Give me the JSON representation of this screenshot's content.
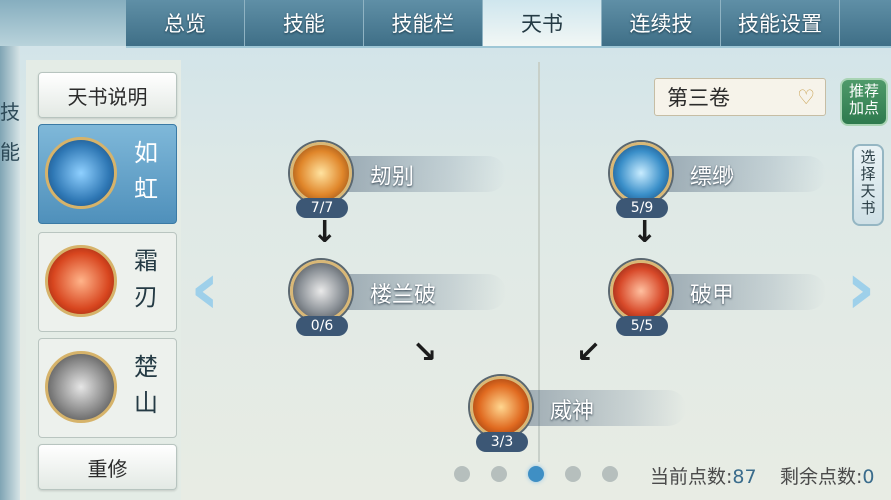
{
  "tabs": [
    "总览",
    "技能",
    "技能栏",
    "天书",
    "连续技",
    "技能设置"
  ],
  "active_tab": "天书",
  "left_edge_chars": [
    "技",
    "能"
  ],
  "left_panel": {
    "info_button": "天书说明",
    "books": [
      {
        "name": "如虹",
        "selected": true,
        "color": "#2f78b5"
      },
      {
        "name": "霜刃",
        "selected": false,
        "color": "#d8461f"
      },
      {
        "name": "楚山",
        "selected": false,
        "color": "#5c5c5c"
      }
    ],
    "reset_button": "重修"
  },
  "volume": {
    "label": "第三卷",
    "icon": "chevron-down-icon"
  },
  "side_buttons": {
    "recommend": "推荐加点",
    "choose": "选择天书"
  },
  "skills": [
    {
      "name": "刼别",
      "level": "7/7",
      "color": "#e0862a"
    },
    {
      "name": "楼兰破",
      "level": "0/6",
      "color": "#8a9096"
    },
    {
      "name": "缥缈",
      "level": "5/9",
      "color": "#3a8fc9"
    },
    {
      "name": "破甲",
      "level": "5/5",
      "color": "#d84a2a"
    },
    {
      "name": "威神",
      "level": "3/3",
      "color": "#e06a20"
    }
  ],
  "pager": {
    "count": 5,
    "active_index": 2
  },
  "points": {
    "current_label": "当前点数:",
    "current_value": "87",
    "remaining_label": "剩余点数:",
    "remaining_value": "0"
  }
}
